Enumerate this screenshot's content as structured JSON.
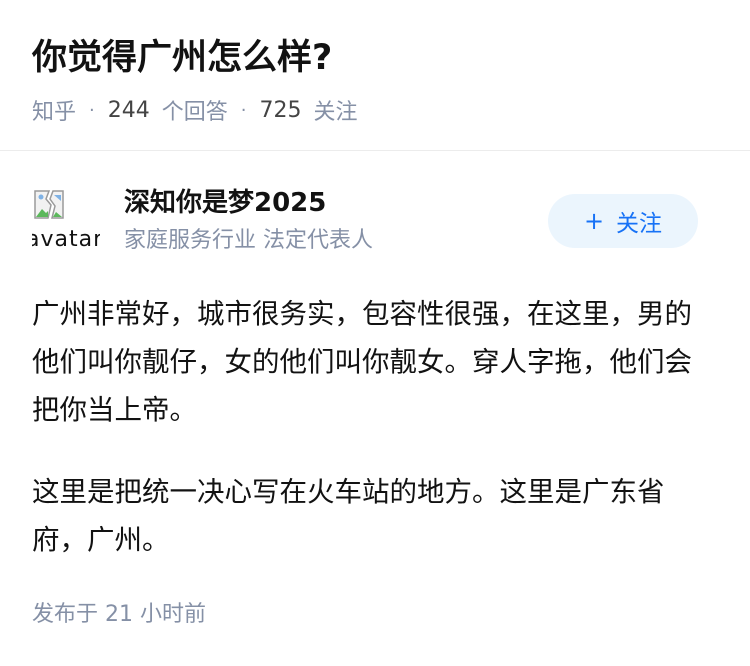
{
  "question": {
    "title": "你觉得广州怎么样?",
    "source": "知乎",
    "answer_count": "244",
    "answer_label": "个回答",
    "follow_count": "725",
    "follow_label": "关注",
    "separator": "·"
  },
  "author": {
    "avatar_alt": "avatar",
    "avatar_icon": "broken-image-icon",
    "name": "深知你是梦2025",
    "headline": "家庭服务行业 法定代表人",
    "follow_button": {
      "icon": "+",
      "label": "关注",
      "background": "#ebf5fd",
      "color": "#1772f6"
    }
  },
  "answer": {
    "paragraphs": [
      "广州非常好，城市很务实，包容性很强，在这里，男的他们叫你靓仔，女的他们叫你靓女。穿人字拖，他们会把你当上帝。",
      "这里是把统一决心写在火车站的地方。这里是广东省府，广州。"
    ],
    "published": "发布于 21 小时前"
  },
  "colors": {
    "primary_text": "#121212",
    "secondary_text": "#8590a6",
    "divider": "#ececec"
  }
}
